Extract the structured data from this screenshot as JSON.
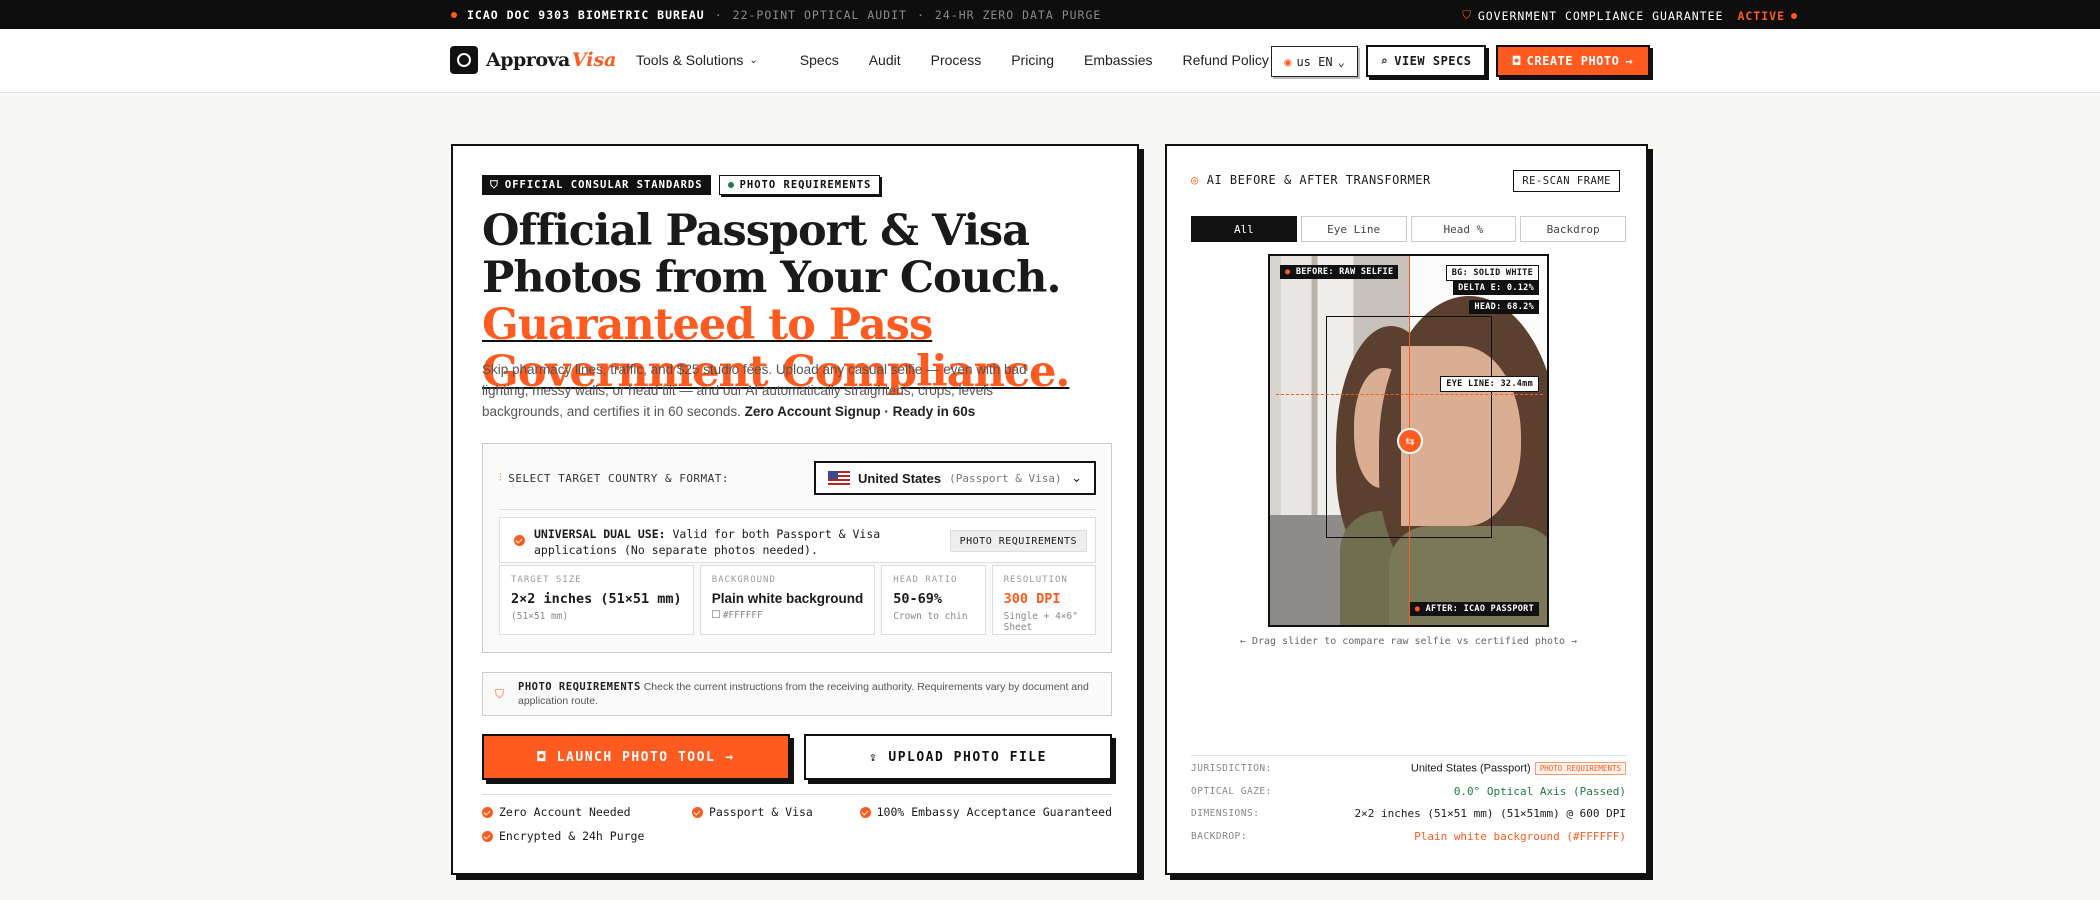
{
  "topbar": {
    "left": [
      "ICAO DOC 9303 BIOMETRIC BUREAU",
      "22-POINT OPTICAL AUDIT",
      "24-HR ZERO DATA PURGE"
    ],
    "guarantee": "GOVERNMENT COMPLIANCE GUARANTEE",
    "status": "ACTIVE"
  },
  "nav": {
    "brand": "Approva",
    "brand_accent": "Visa",
    "links": [
      "Tools & Solutions",
      "Specs",
      "Audit",
      "Process",
      "Pricing",
      "Embassies",
      "Refund Policy"
    ],
    "lang": "us EN",
    "view_specs": "VIEW SPECS",
    "create_photo": "CREATE PHOTO"
  },
  "hero": {
    "tag1": "OFFICIAL CONSULAR STANDARDS",
    "tag2": "PHOTO REQUIREMENTS",
    "title_a": "Official Passport & Visa Photos from Your Couch.",
    "title_b": "Guaranteed to Pass Government Compliance.",
    "subtitle": "Skip pharmacy lines, traffic, and $25 studio fees. Upload any casual selfie — even with bad lighting, messy walls, or head tilt — and our AI automatically straightens, crops, levels backgrounds, and certifies it in 60 seconds.",
    "subtitle_bold": "Zero Account Signup · Ready in 60s"
  },
  "selector": {
    "label": "SELECT TARGET COUNTRY & FORMAT:",
    "country": "United States",
    "format": "(Passport & Visa)",
    "dual_label": "UNIVERSAL DUAL USE:",
    "dual_text": "Valid for both Passport & Visa applications (No separate photos needed).",
    "req_button": "PHOTO REQUIREMENTS",
    "specs": [
      {
        "k": "TARGET SIZE",
        "v": "2×2 inches (51×51 mm)",
        "s": "(51×51 mm)"
      },
      {
        "k": "BACKGROUND",
        "v": "Plain white background",
        "s": "#FFFFFF"
      },
      {
        "k": "HEAD RATIO",
        "v": "50-69%",
        "s": "Crown to chin"
      },
      {
        "k": "RESOLUTION",
        "v": "300 DPI",
        "s": "Single + 4×6\" Sheet"
      }
    ]
  },
  "notice": {
    "title": "PHOTO REQUIREMENTS",
    "text": "Check the current instructions from the receiving authority. Requirements vary by document and application route."
  },
  "actions": {
    "launch": "LAUNCH PHOTO TOOL",
    "upload": "UPLOAD PHOTO FILE"
  },
  "features": [
    "Zero Account Needed",
    "Passport & Visa",
    "100% Embassy Acceptance Guaranteed",
    "Encrypted & 24h Purge"
  ],
  "transformer": {
    "title": "AI BEFORE & AFTER TRANSFORMER",
    "rescan": "RE-SCAN FRAME",
    "tabs": [
      "All",
      "Eye Line",
      "Head %",
      "Backdrop"
    ],
    "before_label": "BEFORE: RAW SELFIE",
    "after_label": "AFTER: ICAO PASSPORT",
    "bg": "BG: SOLID WHITE",
    "delta": "DELTA E: 0.12%",
    "head": "HEAD: 68.2%",
    "eye": "EYE LINE: 32.4mm",
    "hint": "← Drag slider to compare raw selfie vs certified photo →"
  },
  "meta": {
    "jurisdiction_k": "JURISDICTION:",
    "jurisdiction_v": "United States (Passport)",
    "jurisdiction_pill": "PHOTO REQUIREMENTS",
    "gaze_k": "OPTICAL GAZE:",
    "gaze_v": "0.0° Optical Axis (Passed)",
    "dim_k": "DIMENSIONS:",
    "dim_v": "2×2 inches (51×51 mm) (51×51mm) @ 600 DPI",
    "backdrop_k": "BACKDROP:",
    "backdrop_v": "Plain white background (#FFFFFF)"
  },
  "colors": {
    "accent": "#ff5a1f",
    "ink": "#111111",
    "pass": "#1f7a4a"
  }
}
